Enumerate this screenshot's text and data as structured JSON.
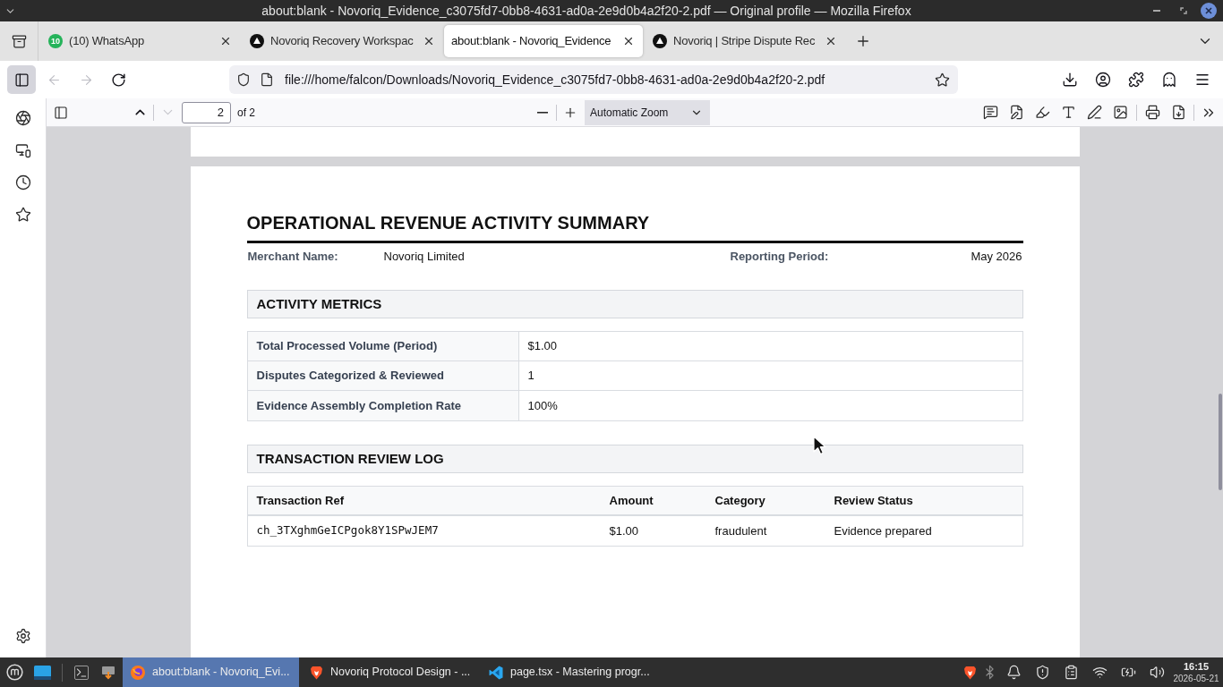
{
  "window": {
    "title": "about:blank - Novoriq_Evidence_c3075fd7-0bb8-4631-ad0a-2e9d0b4a2f20-2.pdf — Original profile — Mozilla Firefox"
  },
  "tabs": [
    {
      "kind": "chat",
      "badge": "10",
      "label": "(10) WhatsApp",
      "selected": false
    },
    {
      "kind": "logo",
      "label": "Novoriq Recovery Workspac",
      "selected": false
    },
    {
      "kind": "plain",
      "label": "about:blank - Novoriq_Evidence",
      "selected": true
    },
    {
      "kind": "logo",
      "label": "Novoriq | Stripe Dispute Rec",
      "selected": false
    }
  ],
  "toolbar": {
    "sidebar_button": {
      "selected": true
    },
    "nav_buttons": [
      {
        "kind": "back",
        "disabled": true
      },
      {
        "kind": "forward",
        "disabled": true
      },
      {
        "kind": "reload",
        "disabled": false
      }
    ],
    "url": "file:///home/falcon/Downloads/Novoriq_Evidence_c3075fd7-0bb8-4631-ad0a-2e9d0b4a2f20-2.pdf"
  },
  "pdf_toolbar": {
    "page_buttons": [
      {
        "kind": "previous",
        "disabled": false
      },
      {
        "kind": "next",
        "disabled": true
      }
    ],
    "page": "2",
    "page_count": "of 2",
    "zoom": "Automatic Zoom"
  },
  "document": {
    "title": "OPERATIONAL REVENUE ACTIVITY SUMMARY",
    "meta": [
      {
        "label": "Merchant Name:",
        "value": "Novoriq Limited"
      },
      {
        "label": "Reporting Period:",
        "value": "May 2026"
      }
    ],
    "sections": [
      {
        "kind": "metrics",
        "title": "ACTIVITY METRICS",
        "rows": [
          {
            "label": "Total Processed Volume (Period)",
            "value": "$1.00"
          },
          {
            "label": "Disputes Categorized & Reviewed",
            "value": "1"
          },
          {
            "label": "Evidence Assembly Completion Rate",
            "value": "100%"
          }
        ]
      },
      {
        "kind": "log",
        "title": "TRANSACTION REVIEW LOG",
        "columns": [
          "Transaction Ref",
          "Amount",
          "Category",
          "Review Status"
        ],
        "rows": [
          [
            "ch_3TXghmGeICPgok8Y1SPwJEM7",
            "$1.00",
            "fraudulent",
            "Evidence prepared"
          ]
        ]
      }
    ]
  },
  "taskbar": {
    "tasks": [
      {
        "kind": "firefox",
        "label": "about:blank - Novoriq_Evi...",
        "selected": true
      },
      {
        "kind": "brave",
        "label": "Novoriq Protocol Design - ...",
        "selected": false
      },
      {
        "kind": "vscode",
        "label": "page.tsx - Mastering progr...",
        "selected": false
      }
    ],
    "clock": {
      "time": "16:15",
      "date": "2026-05-21"
    }
  }
}
